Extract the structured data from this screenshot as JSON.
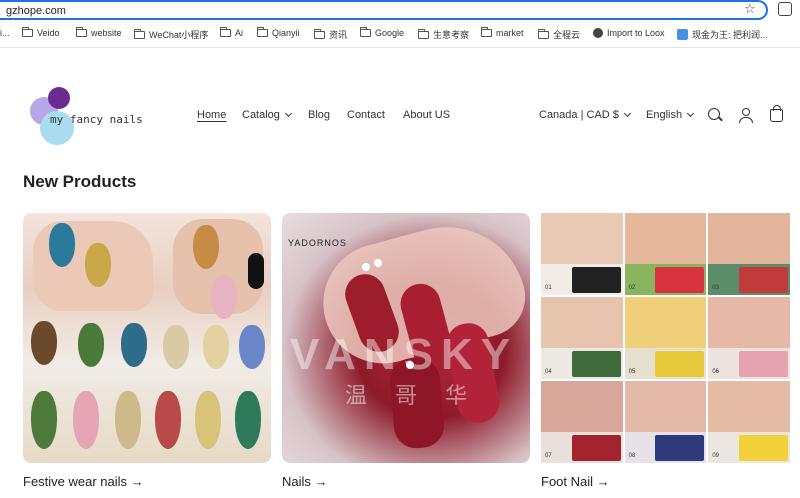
{
  "browser": {
    "url": "gzhope.com",
    "bookmarks": [
      {
        "label": "i...",
        "icon": "folder-icon"
      },
      {
        "label": "Veido",
        "icon": "folder-icon"
      },
      {
        "label": "website",
        "icon": "folder-icon"
      },
      {
        "label": "WeChat小程序",
        "icon": "folder-icon"
      },
      {
        "label": "Ai",
        "icon": "folder-icon"
      },
      {
        "label": "Qianyii",
        "icon": "folder-icon"
      },
      {
        "label": "资讯",
        "icon": "folder-icon"
      },
      {
        "label": "Google",
        "icon": "folder-icon"
      },
      {
        "label": "生意考察",
        "icon": "folder-icon"
      },
      {
        "label": "market",
        "icon": "folder-icon"
      },
      {
        "label": "全程云",
        "icon": "folder-icon"
      },
      {
        "label": "Import to Loox",
        "icon": "globe-icon"
      },
      {
        "label": "现金为王: 把利润...",
        "icon": "app-icon"
      }
    ]
  },
  "header": {
    "logo_text": "my fancy nails",
    "nav": [
      {
        "label": "Home",
        "active": true
      },
      {
        "label": "Catalog",
        "dropdown": true
      },
      {
        "label": "Blog"
      },
      {
        "label": "Contact"
      },
      {
        "label": "About US"
      }
    ],
    "currency": "Canada | CAD $",
    "language": "English"
  },
  "section": {
    "title": "New Products",
    "products": [
      {
        "title": "Festive wear nails →"
      },
      {
        "title": "Nails →",
        "image_brand": "YADORNOS",
        "watermark": "VANSKY",
        "watermark_cn": "温哥华"
      },
      {
        "title": "Foot Nail →",
        "grid_labels": [
          "01",
          "02",
          "03",
          "04",
          "05",
          "06",
          "07",
          "08",
          "09"
        ]
      }
    ]
  },
  "colors": {
    "accent": "#1a73e8",
    "logo_purple_light": "#b8a7e6",
    "logo_purple_dark": "#6a2c91",
    "logo_blue": "#a9dcee"
  }
}
